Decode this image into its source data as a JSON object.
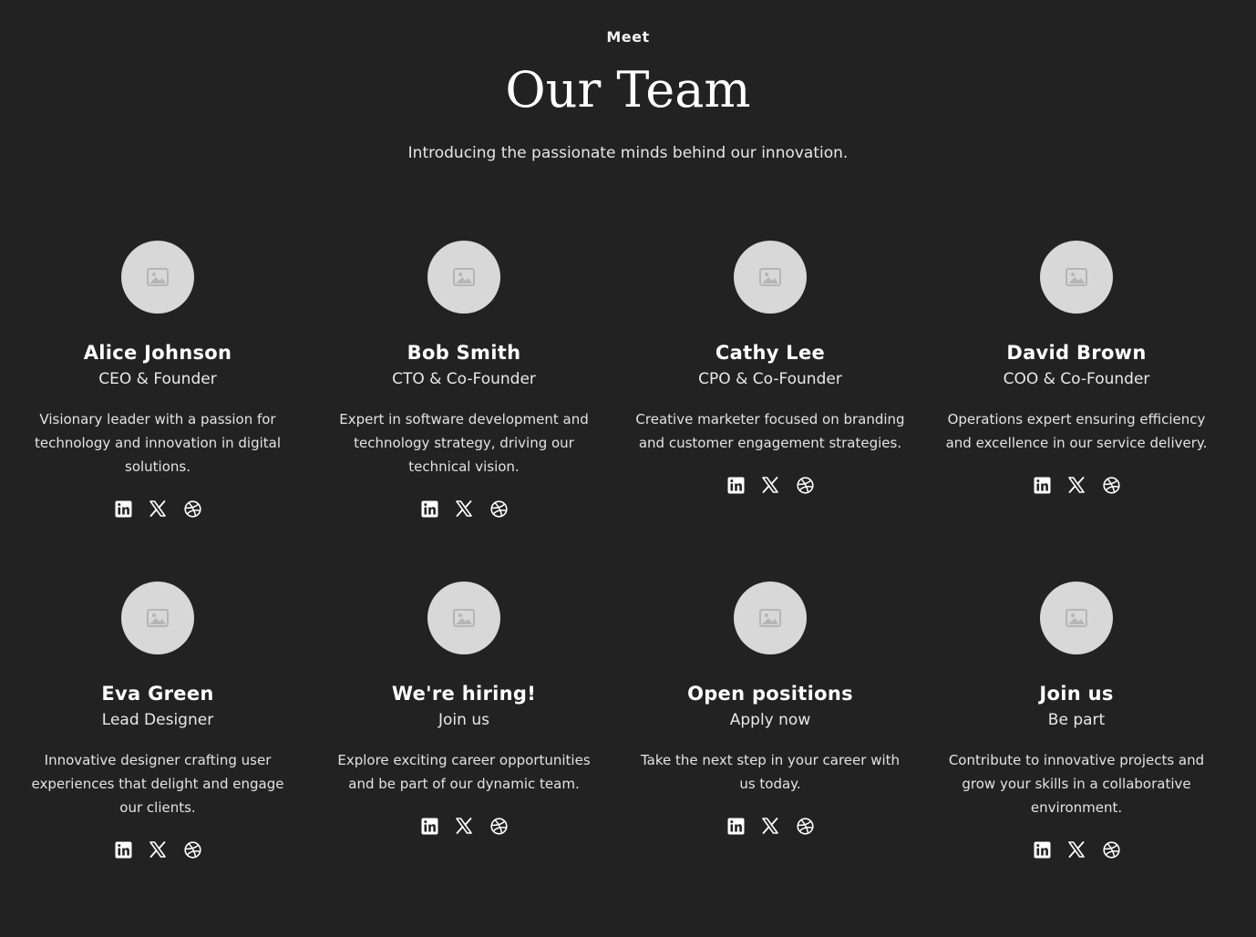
{
  "header": {
    "eyebrow": "Meet",
    "title": "Our Team",
    "subtitle": "Introducing the passionate minds behind our innovation."
  },
  "colors": {
    "background": "#222222",
    "avatar": "#d8d8d8",
    "text": "#ffffff"
  },
  "icons": {
    "avatar": "image-placeholder-icon",
    "socials": [
      "linkedin-icon",
      "x-icon",
      "dribbble-icon"
    ]
  },
  "members": [
    {
      "name": "Alice Johnson",
      "role": "CEO & Founder",
      "bio": "Visionary leader with a passion for technology and innovation in digital solutions."
    },
    {
      "name": "Bob Smith",
      "role": "CTO & Co-Founder",
      "bio": "Expert in software development and technology strategy, driving our technical vision."
    },
    {
      "name": "Cathy Lee",
      "role": "CPO & Co-Founder",
      "bio": "Creative marketer focused on branding and customer engagement strategies."
    },
    {
      "name": "David Brown",
      "role": "COO & Co-Founder",
      "bio": "Operations expert ensuring efficiency and excellence in our service delivery."
    },
    {
      "name": "Eva Green",
      "role": "Lead Designer",
      "bio": "Innovative designer crafting user experiences that delight and engage our clients."
    },
    {
      "name": "We're hiring!",
      "role": "Join us",
      "bio": "Explore exciting career opportunities and be part of our dynamic team."
    },
    {
      "name": "Open positions",
      "role": "Apply now",
      "bio": "Take the next step in your career with us today."
    },
    {
      "name": "Join us",
      "role": "Be part",
      "bio": "Contribute to innovative projects and grow your skills in a collaborative environment."
    }
  ]
}
